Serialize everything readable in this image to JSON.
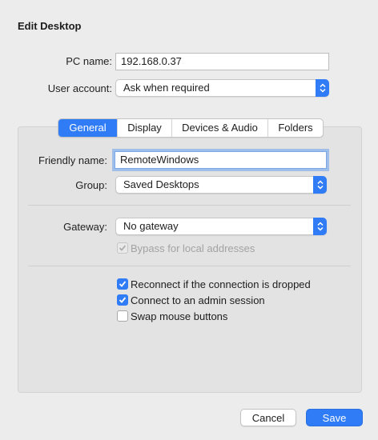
{
  "dialog": {
    "title": "Edit Desktop"
  },
  "pc_name": {
    "label": "PC name:",
    "value": "192.168.0.37"
  },
  "user_account": {
    "label": "User account:",
    "value": "Ask when required"
  },
  "tabs": [
    {
      "label": "General",
      "active": true
    },
    {
      "label": "Display",
      "active": false
    },
    {
      "label": "Devices & Audio",
      "active": false
    },
    {
      "label": "Folders",
      "active": false
    }
  ],
  "general": {
    "friendly_name": {
      "label": "Friendly name:",
      "value": "RemoteWindows"
    },
    "group": {
      "label": "Group:",
      "value": "Saved Desktops"
    },
    "gateway": {
      "label": "Gateway:",
      "value": "No gateway"
    },
    "bypass": {
      "label": "Bypass for local addresses",
      "checked": true,
      "enabled": false
    },
    "options": [
      {
        "label": "Reconnect if the connection is dropped",
        "checked": true
      },
      {
        "label": "Connect to an admin session",
        "checked": true
      },
      {
        "label": "Swap mouse buttons",
        "checked": false
      }
    ]
  },
  "buttons": {
    "cancel": "Cancel",
    "save": "Save"
  },
  "colors": {
    "accent": "#2f7cf6",
    "window_bg": "#ececec",
    "panel_bg": "#e3e3e3"
  }
}
